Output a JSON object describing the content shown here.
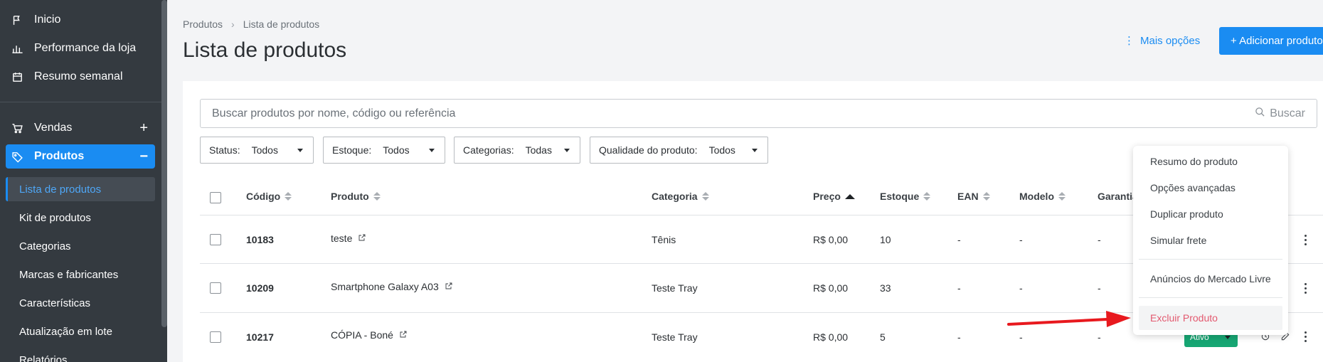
{
  "sidebar": {
    "items": [
      {
        "label": "Inicio",
        "icon": "flag-icon"
      },
      {
        "label": "Performance da loja",
        "icon": "bar-chart-icon"
      },
      {
        "label": "Resumo semanal",
        "icon": "calendar-icon"
      },
      {
        "label": "Vendas",
        "icon": "cart-icon",
        "action": "+"
      },
      {
        "label": "Produtos",
        "icon": "tag-icon",
        "action": "−"
      }
    ],
    "subitems": [
      "Lista de produtos",
      "Kit de produtos",
      "Categorias",
      "Marcas e fabricantes",
      "Características",
      "Atualização em lote",
      "Relatórios"
    ]
  },
  "header": {
    "breadcrumb": [
      "Produtos",
      "Lista de produtos"
    ],
    "title": "Lista de produtos",
    "more_options": "Mais opções",
    "add_button": "+ Adicionar produto"
  },
  "search": {
    "placeholder": "Buscar produtos por nome, código ou referência",
    "button": "Buscar"
  },
  "filters": [
    {
      "label": "Status:",
      "value": "Todos"
    },
    {
      "label": "Estoque:",
      "value": "Todos"
    },
    {
      "label": "Categorias:",
      "value": "Todas"
    },
    {
      "label": "Qualidade do produto:",
      "value": "Todos"
    }
  ],
  "table": {
    "columns": [
      "Código",
      "Produto",
      "Categoria",
      "Preço",
      "Estoque",
      "EAN",
      "Modelo",
      "Garantia"
    ],
    "rows": [
      {
        "code": "10183",
        "product": "teste",
        "category": "Tênis",
        "price": "R$ 0,00",
        "stock": "10",
        "ean": "-",
        "model": "-",
        "warranty": "-"
      },
      {
        "code": "10209",
        "product": "Smartphone Galaxy A03",
        "category": "Teste Tray",
        "price": "R$ 0,00",
        "stock": "33",
        "ean": "-",
        "model": "-",
        "warranty": "-"
      },
      {
        "code": "10217",
        "product": "CÓPIA - Boné",
        "category": "Teste Tray",
        "price": "R$ 0,00",
        "stock": "5",
        "ean": "-",
        "model": "-",
        "warranty": "-"
      }
    ],
    "status_label": "Ativo"
  },
  "menu": {
    "items": [
      "Resumo do produto",
      "Opções avançadas",
      "Duplicar produto",
      "Simular frete",
      "Anúncios do Mercado Livre"
    ],
    "danger": "Excluir Produto"
  },
  "colors": {
    "sidebar": "#343a40",
    "accent": "#1a8cf2",
    "success": "#17a673",
    "danger": "#e3596f",
    "annotation_arrow": "#e8191e"
  }
}
